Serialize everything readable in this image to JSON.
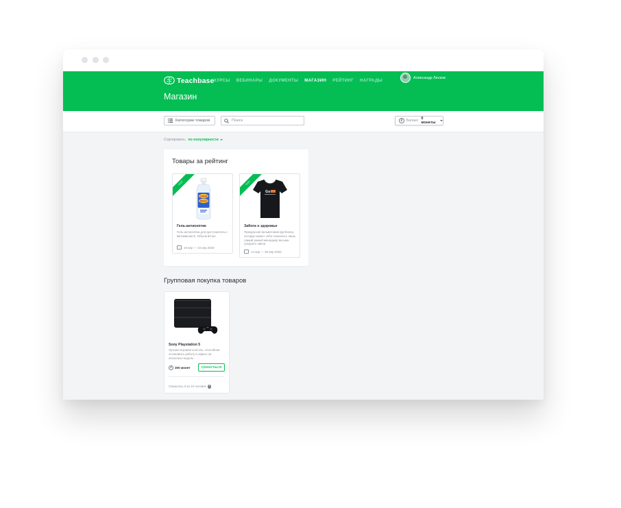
{
  "app": {
    "logo_text": "Teachbase",
    "nav": [
      "КУРСЫ",
      "ВЕБИНАРЫ",
      "ДОКУМЕНТЫ",
      "МАГАЗИН",
      "РЕЙТИНГ",
      "НАГРАДЫ"
    ],
    "active_nav_index": 3,
    "user_name": "Александр Лесков",
    "page_title": "Магазин",
    "brand_color": "#04be54"
  },
  "toolbar": {
    "categories_label": "Категории товаров",
    "search_placeholder": "Поиск",
    "balance_label": "Баланс:",
    "balance_value": "0 монеты"
  },
  "sort": {
    "label": "Сортировать:",
    "value": "по популярности"
  },
  "rating_section": {
    "title": "Товары за рейтинг",
    "items": [
      {
        "badge": "ТОП",
        "name": "Гель-антисептик",
        "description": "Гель-антисептик для рук Санитель с Витамином Е. Объем 50 мл",
        "dates": "19 апр — 23 апр 2020",
        "image_icon": "sanitizer-bottle"
      },
      {
        "badge": "ТОП",
        "name": "Забота о здоровье",
        "description": "Прекрасная вельветовая футболка, которую может себе позволить лишь самый умный менеджер весьма среднего звена",
        "dates": "14 апр — 30 апр 2020",
        "image_icon": "black-tshirt"
      }
    ]
  },
  "group_section": {
    "title": "Групповая покупка товаров",
    "items": [
      {
        "name": "Sony Playstation 5",
        "description": "Лучшая игровая консоль, способная остановить работу в офисе на несколько недель",
        "price": "300 монет",
        "button_label": "СКИНУТЬСЯ",
        "joined": "Скинулось 0 из 10 человек",
        "image_icon": "game-console"
      }
    ]
  }
}
